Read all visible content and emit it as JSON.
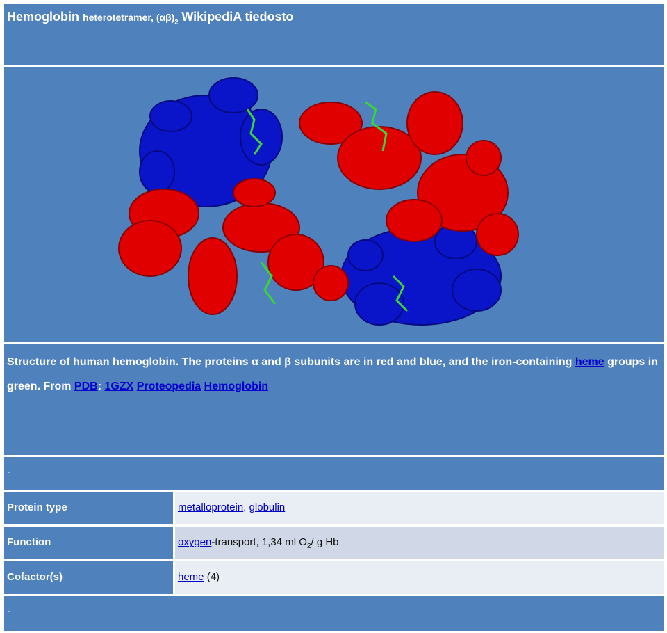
{
  "header": {
    "title_main": "Hemoglobin",
    "title_small": "heterotetramer, (αβ)",
    "title_sub": "2",
    "title_tail": "WikipediA tiedosto"
  },
  "image": {
    "icon": "protein-structure-image",
    "colors": {
      "alpha_subunit": "#e00000",
      "beta_subunit": "#0a14c8",
      "heme": "#3cd23c",
      "background": "#4f81bd"
    }
  },
  "caption": {
    "text_1": "Structure of human hemoglobin. The proteins α and β subunits are in red and blue, and the iron-containing ",
    "link_heme": "heme",
    "text_2": " groups in green. From ",
    "link_pdb": "PDB",
    "sep": ": ",
    "link_1gzx": "1GZX",
    "link_proteopedia": "Proteopedia",
    "link_hemoglobin": "Hemoglobin"
  },
  "divider_1": "-",
  "infobox": {
    "protein_type_label": "Protein type",
    "protein_type_link_1": "metalloprotein",
    "protein_type_sep": ", ",
    "protein_type_link_2": "globulin",
    "function_label": "Function",
    "function_link": "oxygen",
    "function_text": "-transport, 1,34 ml O",
    "function_sub": "2",
    "function_tail": "/ g Hb",
    "cofactor_label": "Cofactor(s)",
    "cofactor_link": "heme",
    "cofactor_text": " (4)"
  },
  "divider_2": "-"
}
